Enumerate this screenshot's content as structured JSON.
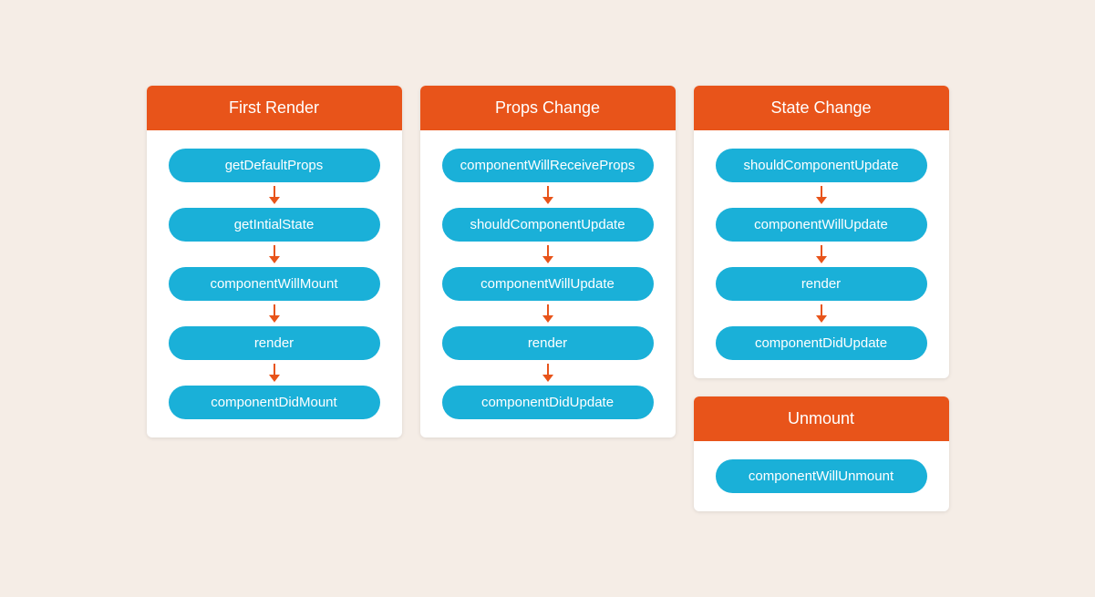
{
  "cards": {
    "first_render": {
      "title": "First Render",
      "steps": [
        "getDefaultProps",
        "getIntialState",
        "componentWillMount",
        "render",
        "componentDidMount"
      ]
    },
    "props_change": {
      "title": "Props Change",
      "steps": [
        "componentWillReceiveProps",
        "shouldComponentUpdate",
        "componentWillUpdate",
        "render",
        "componentDidUpdate"
      ]
    },
    "state_change": {
      "title": "State Change",
      "steps": [
        "shouldComponentUpdate",
        "componentWillUpdate",
        "render",
        "componentDidUpdate"
      ]
    },
    "unmount": {
      "title": "Unmount",
      "steps": [
        "componentWillUnmount"
      ]
    }
  }
}
